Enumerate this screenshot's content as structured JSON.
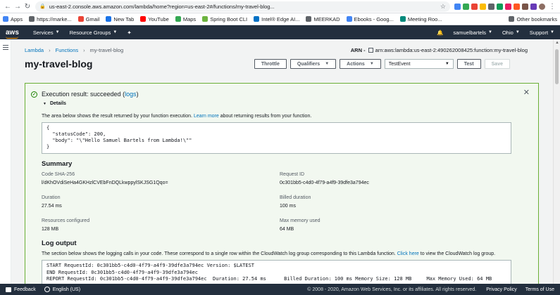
{
  "browser": {
    "url": "us-east-2.console.aws.amazon.com/lambda/home?region=us-east-2#/functions/my-travel-blog..."
  },
  "bookmarks": {
    "items": [
      "Apps",
      "https://marke...",
      "Gmail",
      "New Tab",
      "YouTube",
      "Maps",
      "Spring Boot CLI",
      "Intel® Edge AI...",
      "MEERKAD",
      "Ebooks - Goog...",
      "Meeting Roo..."
    ],
    "other": "Other bookmarks"
  },
  "aws_nav": {
    "logo": "aws",
    "services": "Services",
    "resource_groups": "Resource Groups",
    "user": "samuelbartels",
    "region": "Ohio",
    "support": "Support"
  },
  "breadcrumb": {
    "lambda": "Lambda",
    "functions": "Functions",
    "current": "my-travel-blog"
  },
  "arn": {
    "label": "ARN -",
    "value": "arn:aws:lambda:us-east-2:490262008425:function:my-travel-blog"
  },
  "page": {
    "title": "my-travel-blog"
  },
  "toolbar": {
    "throttle": "Throttle",
    "qualifiers": "Qualifiers",
    "actions": "Actions",
    "test_event": "TestEvent",
    "test": "Test",
    "save": "Save"
  },
  "result": {
    "title_prefix": "Execution result: succeeded (",
    "logs_link": "logs",
    "title_suffix": ")",
    "details": "Details",
    "desc_prefix": "The area below shows the result returned by your function execution. ",
    "learn_more": "Learn more",
    "desc_suffix": " about returning results from your function.",
    "output": "{\n  \"statusCode\": 200,\n  \"body\": \"\\\"Hello Samuel Bartels from Lambda!\\\"\"\n}"
  },
  "summary": {
    "title": "Summary",
    "fields": [
      {
        "label": "Code SHA-256",
        "value": "l/dKhOVdiSeHa4GKHzlCVEbFnDQLkwppylSKJSG1Qqo="
      },
      {
        "label": "Request ID",
        "value": "0c301bb5-c4d0-4f79-a4f9-39dfe3a794ec"
      },
      {
        "label": "Duration",
        "value": "27.54 ms"
      },
      {
        "label": "Billed duration",
        "value": "100 ms"
      },
      {
        "label": "Resources configured",
        "value": "128 MB"
      },
      {
        "label": "Max memory used",
        "value": "64 MB"
      }
    ]
  },
  "log": {
    "title": "Log output",
    "desc_prefix": "The section below shows the logging calls in your code. These correspond to a single row within the CloudWatch log group corresponding to this Lambda function. ",
    "click_here": "Click here",
    "desc_suffix": " to view the CloudWatch log group.",
    "output": "START RequestId: 0c301bb5-c4d0-4f79-a4f9-39dfe3a794ec Version: $LATEST\nEND RequestId: 0c301bb5-c4d0-4f79-a4f9-39dfe3a794ec\nREPORT RequestId: 0c301bb5-c4d0-4f79-a4f9-39dfe3a794ec  Duration: 27.54 ms      Billed Duration: 100 ms Memory Size: 128 MB     Max Memory Used: 64 MB"
  },
  "footer": {
    "feedback": "Feedback",
    "language": "English (US)",
    "copyright": "© 2008 - 2020, Amazon Web Services, Inc. or its affiliates. All rights reserved.",
    "privacy": "Privacy Policy",
    "terms": "Terms of Use"
  }
}
